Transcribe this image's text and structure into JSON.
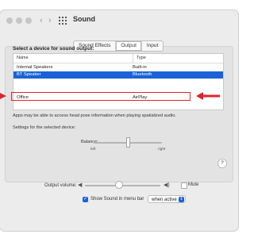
{
  "window": {
    "title": "Sound"
  },
  "nav": {
    "back_glyph": "‹",
    "forward_glyph": "›",
    "grid_icon": "grid-icon"
  },
  "tabs": [
    {
      "label": "Sound Effects",
      "active": false
    },
    {
      "label": "Output",
      "active": true
    },
    {
      "label": "Input",
      "active": false
    }
  ],
  "output": {
    "heading": "Select a device for sound output:",
    "columns": [
      "Name",
      "Type"
    ],
    "devices": [
      {
        "name": "Internal Speakers",
        "type": "Built-in",
        "selected": false
      },
      {
        "name": "BT Speaker",
        "type": "Bluetooth",
        "selected": true
      },
      {
        "name": "Office",
        "type": "AirPlay",
        "selected": false,
        "highlighted": true
      }
    ],
    "note": "Apps may be able to access head pose information when playing spatialized audio.",
    "settings_label": "Settings for the selected device:",
    "balance": {
      "label": "Balance:",
      "left_label": "left",
      "right_label": "right",
      "value": 0.5
    }
  },
  "help": {
    "label": "?"
  },
  "volume": {
    "label": "Output volume:",
    "value": 0.45,
    "mute_label": "Mute",
    "mute_checked": false
  },
  "menubar": {
    "show_label": "Show Sound in menu bar",
    "show_checked": true,
    "select_value": "when active"
  },
  "colors": {
    "accent": "#1a62d6",
    "annotation": "#e0242b"
  }
}
